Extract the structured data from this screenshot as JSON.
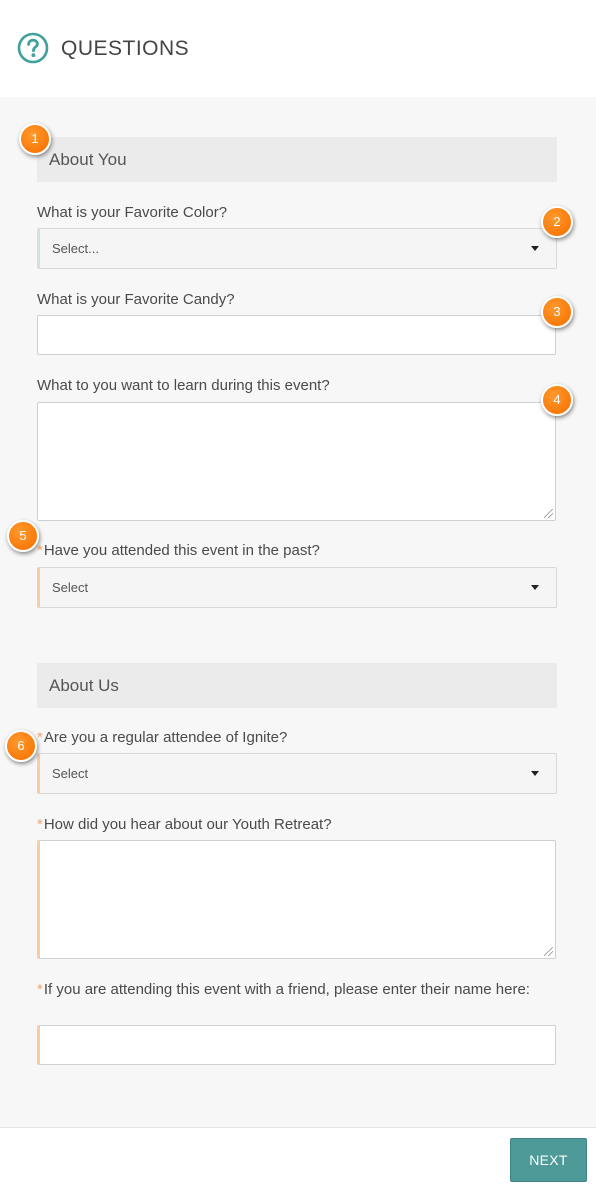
{
  "header": {
    "title": "QUESTIONS",
    "icon": "question-circle-icon"
  },
  "sections": [
    {
      "title": "About You",
      "fields": [
        {
          "label": "What is your Favorite Color?",
          "type": "select",
          "value": "Select...",
          "required": false
        },
        {
          "label": "What is your Favorite Candy?",
          "type": "text",
          "value": "",
          "required": false
        },
        {
          "label": "What to you want to learn during this event?",
          "type": "textarea",
          "value": "",
          "required": false
        },
        {
          "label": "Have you attended this event in the past?",
          "type": "select",
          "value": "Select",
          "required": true
        }
      ]
    },
    {
      "title": "About Us",
      "fields": [
        {
          "label": "Are you a regular attendee of Ignite?",
          "type": "select",
          "value": "Select",
          "required": true
        },
        {
          "label": "How did you hear about our Youth Retreat?",
          "type": "textarea",
          "value": "",
          "required": true
        },
        {
          "label": "If you are attending this event with a friend, please enter their name here:",
          "type": "text",
          "value": "",
          "required": true
        }
      ]
    }
  ],
  "required_mark": "*",
  "markers": [
    "1",
    "2",
    "3",
    "4",
    "5",
    "6"
  ],
  "footer": {
    "next_label": "NEXT"
  },
  "colors": {
    "accent": "#4d9a98",
    "marker": "#f97a0a",
    "required": "#f3a46a"
  }
}
